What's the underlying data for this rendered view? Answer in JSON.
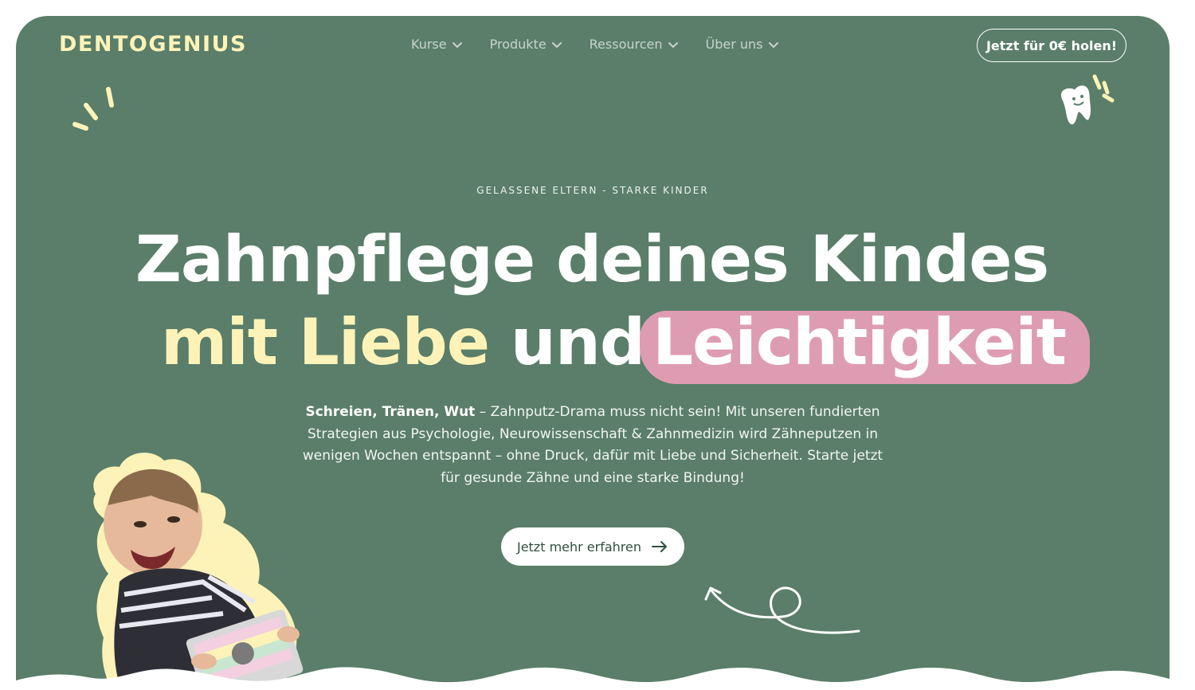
{
  "brand": {
    "logo_text": "DENTOGENIUS",
    "accent": "#fdf3b8",
    "bg": "#5a7e69",
    "pink": "#de9cb2"
  },
  "nav": {
    "items": [
      {
        "label": "Kurse",
        "icon": "chevron-down-icon"
      },
      {
        "label": "Produkte",
        "icon": "chevron-down-icon"
      },
      {
        "label": "Ressourcen",
        "icon": "chevron-down-icon"
      },
      {
        "label": "Über uns",
        "icon": "chevron-down-icon"
      }
    ],
    "cta_label": "Jetzt für 0€ holen!"
  },
  "hero": {
    "eyebrow": "GELASSENE ELTERN - STARKE KINDER",
    "headline_line1": "Zahnpflege deines Kindes",
    "headline_yellow": "mit Liebe",
    "headline_white": "und",
    "headline_pink": "Leichtigkeit",
    "sub_bold": "Schreien, Tränen, Wut",
    "sub_rest": " – Zahnputz-Drama muss nicht sein! Mit unseren fundierten Strategien aus Psychologie, Neurowissenschaft & Zahnmedizin wird Zähneputzen in wenigen Wochen entspannt – ohne Druck, dafür mit Liebe und Sicherheit. Starte jetzt für gesunde Zähne und eine starke Bindung!",
    "cta_label": "Jetzt mehr erfahren",
    "cta_icon": "arrow-right-icon"
  }
}
